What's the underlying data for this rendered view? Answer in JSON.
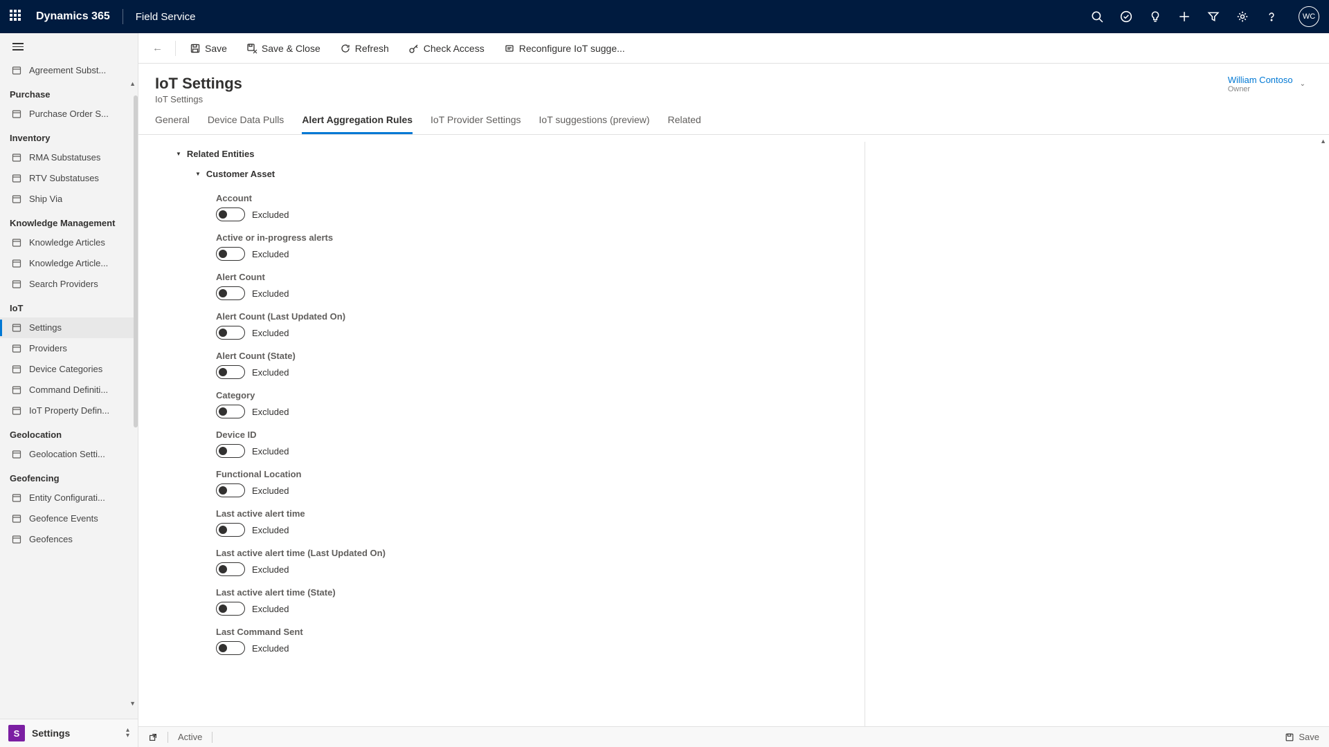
{
  "topbar": {
    "brand": "Dynamics 365",
    "app": "Field Service",
    "avatar": "WC"
  },
  "commands": {
    "save": "Save",
    "saveClose": "Save & Close",
    "refresh": "Refresh",
    "checkAccess": "Check Access",
    "reconfigure": "Reconfigure IoT sugge..."
  },
  "header": {
    "title": "IoT Settings",
    "sub": "IoT Settings",
    "ownerName": "William Contoso",
    "ownerRole": "Owner"
  },
  "tabs": [
    "General",
    "Device Data Pulls",
    "Alert Aggregation Rules",
    "IoT Provider Settings",
    "IoT suggestions (preview)",
    "Related"
  ],
  "activeTab": 2,
  "sidebar": {
    "top_item": "Agreement Subst...",
    "sections": [
      {
        "title": "Purchase",
        "items": [
          "Purchase Order S..."
        ]
      },
      {
        "title": "Inventory",
        "items": [
          "RMA Substatuses",
          "RTV Substatuses",
          "Ship Via"
        ]
      },
      {
        "title": "Knowledge Management",
        "items": [
          "Knowledge Articles",
          "Knowledge Article...",
          "Search Providers"
        ]
      },
      {
        "title": "IoT",
        "items": [
          "Settings",
          "Providers",
          "Device Categories",
          "Command Definiti...",
          "IoT Property Defin..."
        ]
      },
      {
        "title": "Geolocation",
        "items": [
          "Geolocation Setti..."
        ]
      },
      {
        "title": "Geofencing",
        "items": [
          "Entity Configurati...",
          "Geofence Events",
          "Geofences"
        ]
      }
    ],
    "active": "Settings",
    "footer": {
      "badge": "S",
      "label": "Settings"
    }
  },
  "form": {
    "group": "Related Entities",
    "sub": "Customer Asset",
    "excluded": "Excluded",
    "fields": [
      "Account",
      "Active or in-progress alerts",
      "Alert Count",
      "Alert Count (Last Updated On)",
      "Alert Count (State)",
      "Category",
      "Device ID",
      "Functional Location",
      "Last active alert time",
      "Last active alert time (Last Updated On)",
      "Last active alert time (State)",
      "Last Command Sent"
    ]
  },
  "statusbar": {
    "status": "Active",
    "save": "Save"
  }
}
